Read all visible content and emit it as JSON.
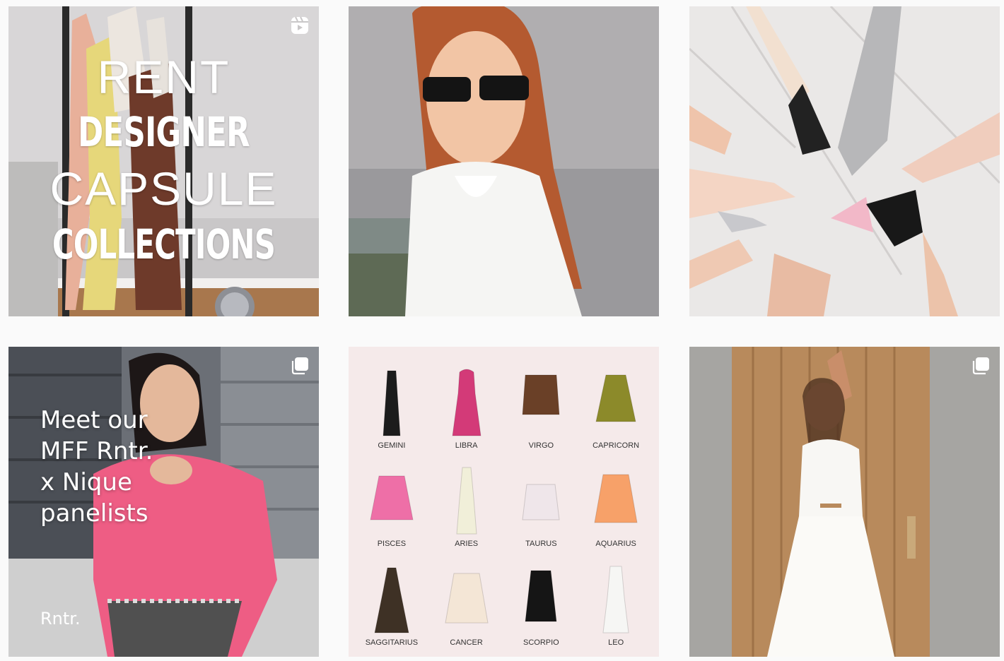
{
  "posts": [
    {
      "id": "post-1",
      "kind": "reel",
      "text_lines": [
        "RENT",
        "DESIGNER",
        "CAPSULE",
        "COLLECTIONS"
      ]
    },
    {
      "id": "post-2",
      "kind": "photo"
    },
    {
      "id": "post-3",
      "kind": "photo"
    },
    {
      "id": "post-4",
      "kind": "carousel",
      "text_lines": [
        "Meet our",
        "MFF Rntr.",
        "x Nique",
        "panelists"
      ],
      "logo": "Rntr."
    },
    {
      "id": "post-5",
      "kind": "photo",
      "zodiac": [
        {
          "label": "GEMINI",
          "color": "#1c1c1c"
        },
        {
          "label": "LIBRA",
          "color": "#d33a78"
        },
        {
          "label": "VIRGO",
          "color": "#6a4027"
        },
        {
          "label": "CAPRICORN",
          "color": "#8c8a2a"
        },
        {
          "label": "PISCES",
          "color": "#ee6fa7"
        },
        {
          "label": "ARIES",
          "color": "#f1efd9"
        },
        {
          "label": "TAURUS",
          "color": "#efe6ea"
        },
        {
          "label": "AQUARIUS",
          "color": "#f7a169"
        },
        {
          "label": "SAGGITARIUS",
          "color": "#3e3125"
        },
        {
          "label": "CANCER",
          "color": "#f4e6d6"
        },
        {
          "label": "SCORPIO",
          "color": "#151515"
        },
        {
          "label": "LEO",
          "color": "#f6f6f4"
        }
      ]
    },
    {
      "id": "post-6",
      "kind": "carousel"
    }
  ]
}
